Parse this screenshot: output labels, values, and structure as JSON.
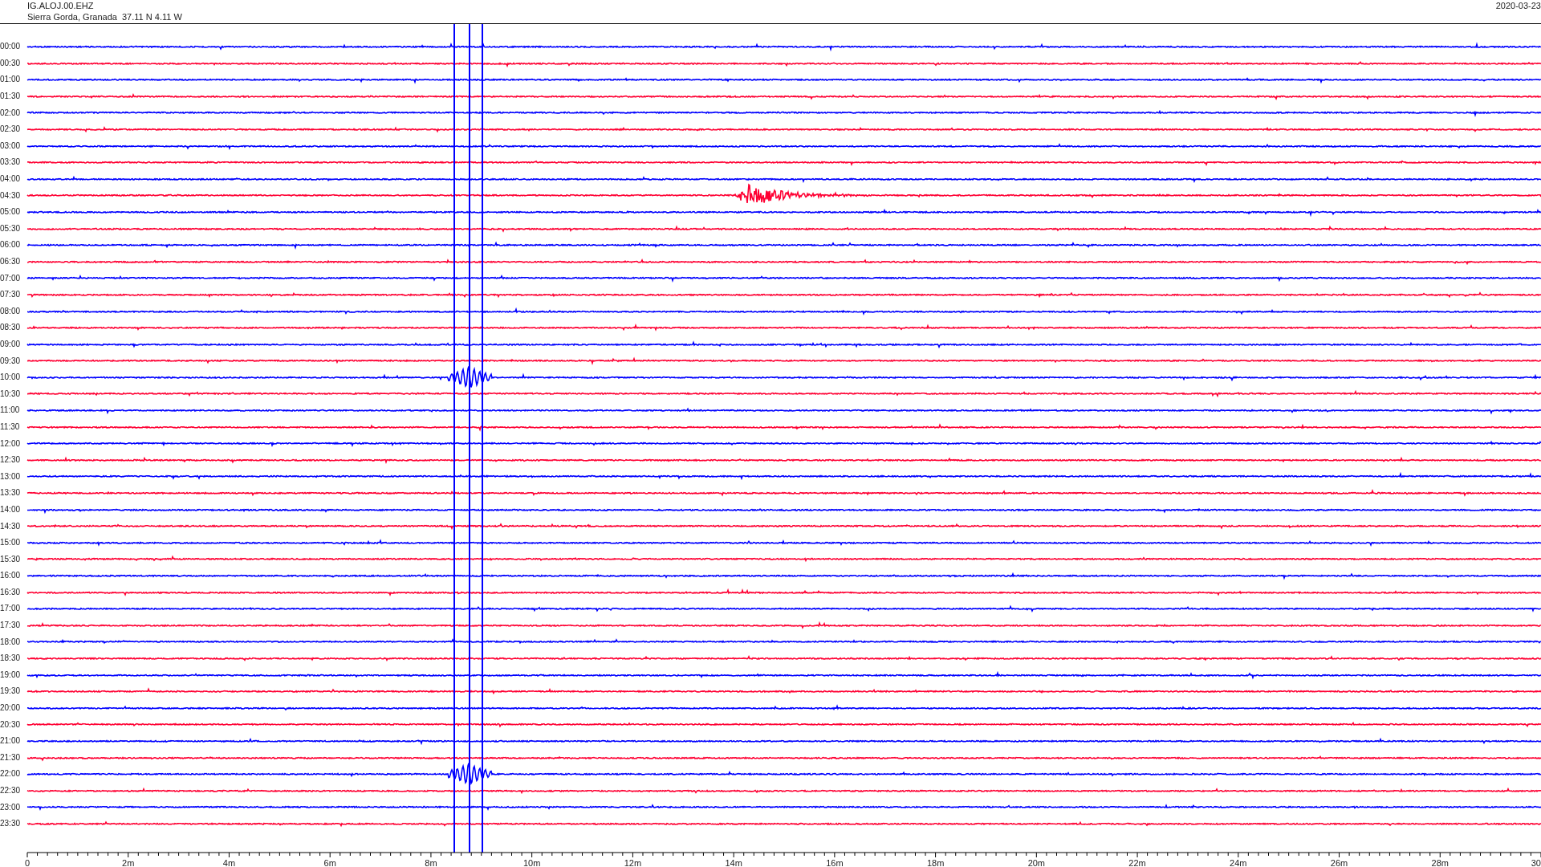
{
  "header": {
    "station": "IG.ALOJ.00.EHZ",
    "location": "Sierra Gorda, Granada  37.11 N 4.11 W",
    "date": "2020-03-23"
  },
  "rows": [
    {
      "label": "00:00",
      "color": "#0000ff"
    },
    {
      "label": "00:30",
      "color": "#ff0033"
    },
    {
      "label": "01:00",
      "color": "#0000ff"
    },
    {
      "label": "01:30",
      "color": "#ff0033"
    },
    {
      "label": "02:00",
      "color": "#0000ff"
    },
    {
      "label": "02:30",
      "color": "#ff0033"
    },
    {
      "label": "03:00",
      "color": "#0000ff"
    },
    {
      "label": "03:30",
      "color": "#ff0033"
    },
    {
      "label": "04:00",
      "color": "#0000ff"
    },
    {
      "label": "04:30",
      "color": "#ff0033"
    },
    {
      "label": "05:00",
      "color": "#0000ff"
    },
    {
      "label": "05:30",
      "color": "#ff0033"
    },
    {
      "label": "06:00",
      "color": "#0000ff"
    },
    {
      "label": "06:30",
      "color": "#ff0033"
    },
    {
      "label": "07:00",
      "color": "#0000ff"
    },
    {
      "label": "07:30",
      "color": "#ff0033"
    },
    {
      "label": "08:00",
      "color": "#0000ff"
    },
    {
      "label": "08:30",
      "color": "#ff0033"
    },
    {
      "label": "09:00",
      "color": "#0000ff"
    },
    {
      "label": "09:30",
      "color": "#ff0033"
    },
    {
      "label": "10:00",
      "color": "#0000ff"
    },
    {
      "label": "10:30",
      "color": "#ff0033"
    },
    {
      "label": "11:00",
      "color": "#0000ff"
    },
    {
      "label": "11:30",
      "color": "#ff0033"
    },
    {
      "label": "12:00",
      "color": "#0000ff"
    },
    {
      "label": "12:30",
      "color": "#ff0033"
    },
    {
      "label": "13:00",
      "color": "#0000ff"
    },
    {
      "label": "13:30",
      "color": "#ff0033"
    },
    {
      "label": "14:00",
      "color": "#0000ff"
    },
    {
      "label": "14:30",
      "color": "#ff0033"
    },
    {
      "label": "15:00",
      "color": "#0000ff"
    },
    {
      "label": "15:30",
      "color": "#ff0033"
    },
    {
      "label": "16:00",
      "color": "#0000ff"
    },
    {
      "label": "16:30",
      "color": "#ff0033"
    },
    {
      "label": "17:00",
      "color": "#0000ff"
    },
    {
      "label": "17:30",
      "color": "#ff0033"
    },
    {
      "label": "18:00",
      "color": "#0000ff"
    },
    {
      "label": "18:30",
      "color": "#ff0033"
    },
    {
      "label": "19:00",
      "color": "#0000ff"
    },
    {
      "label": "19:30",
      "color": "#ff0033"
    },
    {
      "label": "20:00",
      "color": "#0000ff"
    },
    {
      "label": "20:30",
      "color": "#ff0033"
    },
    {
      "label": "21:00",
      "color": "#0000ff"
    },
    {
      "label": "21:30",
      "color": "#ff0033"
    },
    {
      "label": "22:00",
      "color": "#0000ff"
    },
    {
      "label": "22:30",
      "color": "#ff0033"
    },
    {
      "label": "23:00",
      "color": "#0000ff"
    },
    {
      "label": "23:30",
      "color": "#ff0033"
    }
  ],
  "axis": {
    "ticks": [
      "0",
      "2m",
      "4m",
      "6m",
      "8m",
      "10m",
      "12m",
      "14m",
      "16m",
      "18m",
      "20m",
      "22m",
      "24m",
      "26m",
      "28m",
      "30"
    ]
  }
}
